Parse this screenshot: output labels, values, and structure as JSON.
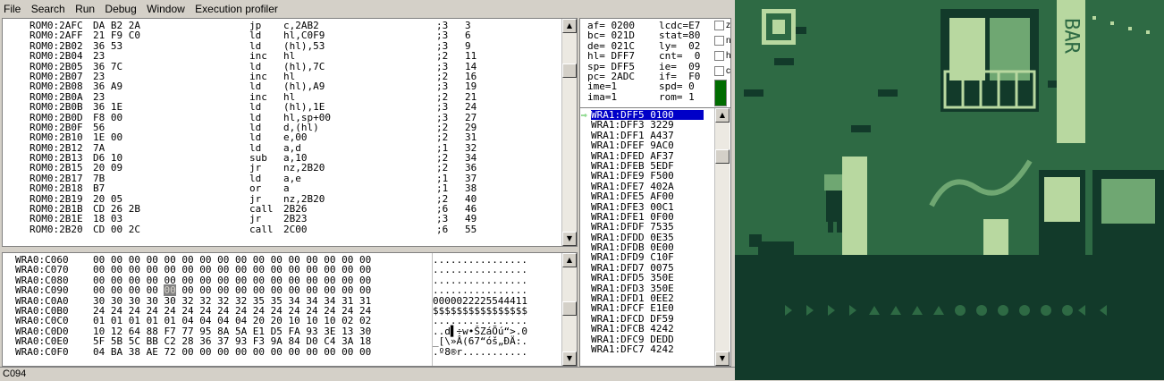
{
  "menu": {
    "file": "File",
    "search": "Search",
    "run": "Run",
    "debug": "Debug",
    "window": "Window",
    "profiler": "Execution profiler"
  },
  "disasm": [
    {
      "addr": "ROM0:2AFC",
      "bytes": "DA B2 2A",
      "mn": "jp",
      "op": "c,2AB2",
      "cy": ";3",
      "n": "3"
    },
    {
      "addr": "ROM0:2AFF",
      "bytes": "21 F9 C0",
      "mn": "ld",
      "op": "hl,C0F9",
      "cy": ";3",
      "n": "6"
    },
    {
      "addr": "ROM0:2B02",
      "bytes": "36 53",
      "mn": "ld",
      "op": "(hl),53",
      "cy": ";3",
      "n": "9"
    },
    {
      "addr": "ROM0:2B04",
      "bytes": "23",
      "mn": "inc",
      "op": "hl",
      "cy": ";2",
      "n": "11"
    },
    {
      "addr": "ROM0:2B05",
      "bytes": "36 7C",
      "mn": "ld",
      "op": "(hl),7C",
      "cy": ";3",
      "n": "14"
    },
    {
      "addr": "ROM0:2B07",
      "bytes": "23",
      "mn": "inc",
      "op": "hl",
      "cy": ";2",
      "n": "16"
    },
    {
      "addr": "ROM0:2B08",
      "bytes": "36 A9",
      "mn": "ld",
      "op": "(hl),A9",
      "cy": ";3",
      "n": "19"
    },
    {
      "addr": "ROM0:2B0A",
      "bytes": "23",
      "mn": "inc",
      "op": "hl",
      "cy": ";2",
      "n": "21"
    },
    {
      "addr": "ROM0:2B0B",
      "bytes": "36 1E",
      "mn": "ld",
      "op": "(hl),1E",
      "cy": ";3",
      "n": "24"
    },
    {
      "addr": "ROM0:2B0D",
      "bytes": "F8 00",
      "mn": "ld",
      "op": "hl,sp+00",
      "cy": ";3",
      "n": "27"
    },
    {
      "addr": "ROM0:2B0F",
      "bytes": "56",
      "mn": "ld",
      "op": "d,(hl)",
      "cy": ";2",
      "n": "29"
    },
    {
      "addr": "ROM0:2B10",
      "bytes": "1E 00",
      "mn": "ld",
      "op": "e,00",
      "cy": ";2",
      "n": "31"
    },
    {
      "addr": "ROM0:2B12",
      "bytes": "7A",
      "mn": "ld",
      "op": "a,d",
      "cy": ";1",
      "n": "32"
    },
    {
      "addr": "ROM0:2B13",
      "bytes": "D6 10",
      "mn": "sub",
      "op": "a,10",
      "cy": ";2",
      "n": "34"
    },
    {
      "addr": "ROM0:2B15",
      "bytes": "20 09",
      "mn": "jr",
      "op": "nz,2B20",
      "cy": ";2",
      "n": "36"
    },
    {
      "addr": "ROM0:2B17",
      "bytes": "7B",
      "mn": "ld",
      "op": "a,e",
      "cy": ";1",
      "n": "37"
    },
    {
      "addr": "ROM0:2B18",
      "bytes": "B7",
      "mn": "or",
      "op": "a",
      "cy": ";1",
      "n": "38"
    },
    {
      "addr": "ROM0:2B19",
      "bytes": "20 05",
      "mn": "jr",
      "op": "nz,2B20",
      "cy": ";2",
      "n": "40"
    },
    {
      "addr": "ROM0:2B1B",
      "bytes": "CD 26 2B",
      "mn": "call",
      "op": "2B26",
      "cy": ";6",
      "n": "46"
    },
    {
      "addr": "ROM0:2B1E",
      "bytes": "18 03",
      "mn": "jr",
      "op": "2B23",
      "cy": ";3",
      "n": "49"
    },
    {
      "addr": "ROM0:2B20",
      "bytes": "CD 00 2C",
      "mn": "call",
      "op": "2C00",
      "cy": ";6",
      "n": "55"
    }
  ],
  "memory": [
    {
      "addr": "WRA0:C060",
      "pre": "00 00 00 00 00 00 00 00 00 00 00 00 00 00 00 00",
      "cell": "",
      "post": "",
      "asc": "................"
    },
    {
      "addr": "WRA0:C070",
      "pre": "00 00 00 00 00 00 00 00 00 00 00 00 00 00 00 00",
      "cell": "",
      "post": "",
      "asc": "................"
    },
    {
      "addr": "WRA0:C080",
      "pre": "00 00 00 00 00 00 00 00 00 00 00 00 00 00 00 00",
      "cell": "",
      "post": "",
      "asc": "................"
    },
    {
      "addr": "WRA0:C090",
      "pre": "00 00 00 00 ",
      "cell": "00",
      "post": " 00 00 00 00 00 00 00 00 00 00 00",
      "asc": "................"
    },
    {
      "addr": "WRA0:C0A0",
      "pre": "30 30 30 30 30 32 32 32 32 35 35 34 34 34 31 31",
      "cell": "",
      "post": "",
      "asc": "0000022225544411"
    },
    {
      "addr": "WRA0:C0B0",
      "pre": "24 24 24 24 24 24 24 24 24 24 24 24 24 24 24 24",
      "cell": "",
      "post": "",
      "asc": "$$$$$$$$$$$$$$$$"
    },
    {
      "addr": "WRA0:C0C0",
      "pre": "01 01 01 01 01 04 04 04 04 20 20 10 10 10 02 02",
      "cell": "",
      "post": "",
      "asc": "................"
    },
    {
      "addr": "WRA0:C0D0",
      "pre": "10 12 64 88 F7 77 95 8A 5A E1 D5 FA 93 3E 13 30",
      "cell": "",
      "post": "",
      "asc": "..d▌÷w•ŠZáÕú“>.0"
    },
    {
      "addr": "WRA0:C0E0",
      "pre": "5F 5B 5C BB C2 28 36 37 93 F3 9A 84 D0 C4 3A 18",
      "cell": "",
      "post": "",
      "asc": "_[\\»Â(67“óš„ÐÄ:."
    },
    {
      "addr": "WRA0:C0F0",
      "pre": "04 BA 38 AE 72 00 00 00 00 00 00 00 00 00 00 00",
      "cell": "",
      "post": "",
      "asc": ".º8®r..........."
    }
  ],
  "registers": [
    {
      "a": "af= 0200",
      "b": "lcdc=E7"
    },
    {
      "a": "bc= 021D",
      "b": "stat=80"
    },
    {
      "a": "de= 021C",
      "b": "ly=  02"
    },
    {
      "a": "hl= DFF7",
      "b": "cnt=  0"
    },
    {
      "a": "sp= DFF5",
      "b": "ie=  09"
    },
    {
      "a": "pc= 2ADC",
      "b": "if=  F0"
    },
    {
      "a": "ime=1",
      "b": "spd= 0"
    },
    {
      "a": "ima=1",
      "b": "rom= 1"
    }
  ],
  "flags": [
    "z",
    "n",
    "h",
    "c"
  ],
  "stack": [
    "WRA1:DFF5 0100",
    "WRA1:DFF3 3229",
    "WRA1:DFF1 A437",
    "WRA1:DFEF 9AC0",
    "WRA1:DFED AF37",
    "WRA1:DFEB 5EDF",
    "WRA1:DFE9 F500",
    "WRA1:DFE7 402A",
    "WRA1:DFE5 AF00",
    "WRA1:DFE3 00C1",
    "WRA1:DFE1 0F00",
    "WRA1:DFDF 7535",
    "WRA1:DFDD 0E35",
    "WRA1:DFDB 0E00",
    "WRA1:DFD9 C10F",
    "WRA1:DFD7 0075",
    "WRA1:DFD5 350E",
    "WRA1:DFD3 350E",
    "WRA1:DFD1 0EE2",
    "WRA1:DFCF E1E0",
    "WRA1:DFCD DF59",
    "WRA1:DFCB 4242",
    "WRA1:DFC9 DEDD",
    "WRA1:DFC7 4242"
  ],
  "status": "C094",
  "game": {
    "sign_text": "BAR"
  },
  "colors": {
    "gb_dark": "#123a2a",
    "gb_mid": "#2e6a44",
    "gb_light": "#6fa772",
    "gb_pale": "#b8d8a0",
    "selection": "#0000c8",
    "reg_bar": "#006c00"
  }
}
